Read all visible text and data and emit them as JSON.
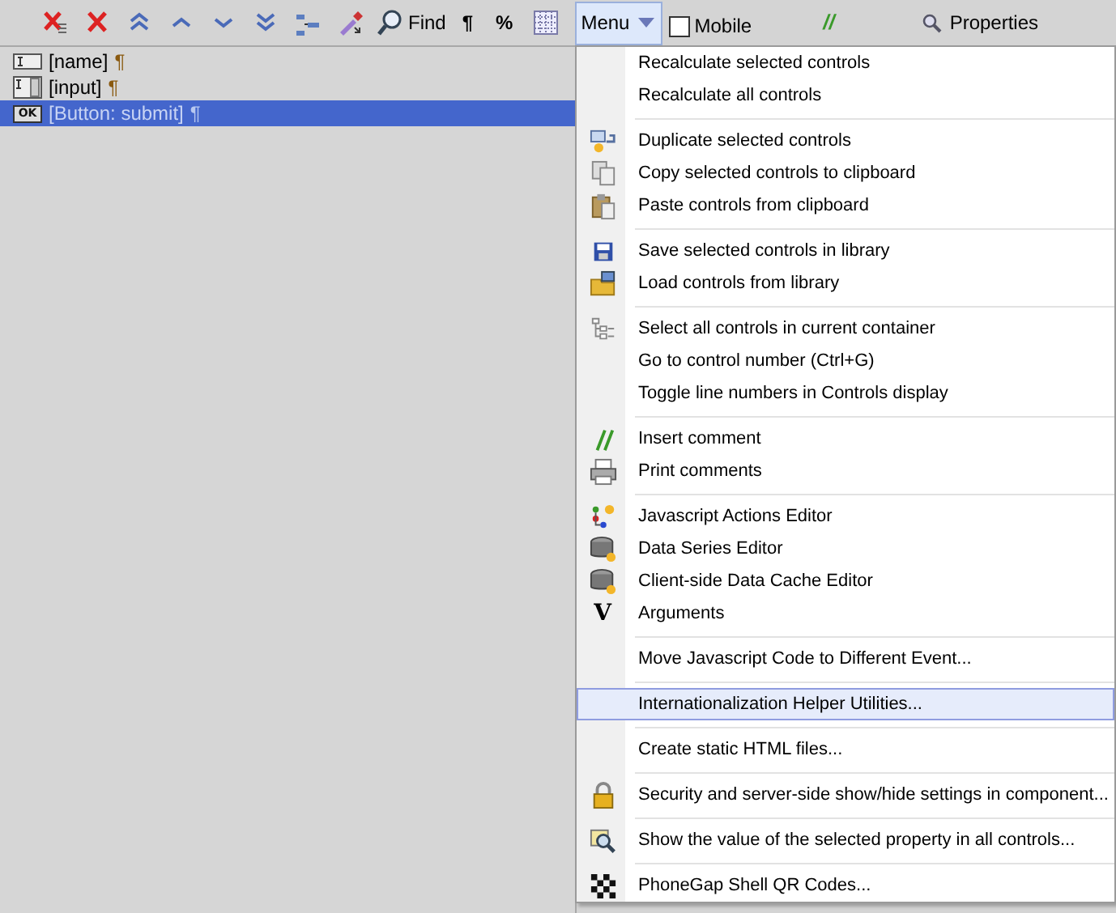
{
  "toolbar": {
    "buttons": [
      {
        "kind": "icon"
      },
      {
        "kind": "icon"
      },
      {
        "kind": "icon"
      },
      {
        "kind": "icon"
      },
      {
        "kind": "icon"
      },
      {
        "kind": "icon"
      },
      {
        "kind": "icon"
      },
      {
        "kind": "icon"
      },
      {
        "kind": "labeled",
        "label": "Find"
      },
      {
        "kind": "text",
        "label": "¶"
      },
      {
        "kind": "text",
        "label": "%"
      },
      {
        "kind": "icon"
      }
    ],
    "menu_button": {
      "label": "Menu",
      "selected": true
    },
    "mobile": {
      "label": "Mobile",
      "checked": false
    },
    "comment_mark": "//",
    "properties": {
      "label": "Properties"
    }
  },
  "controls": [
    {
      "label": "[name]",
      "mark": "¶",
      "selected": false
    },
    {
      "label": "[input]",
      "mark": "¶",
      "selected": false
    },
    {
      "badge": "OK",
      "label": "[Button: submit]",
      "mark": "¶",
      "selected": true
    }
  ],
  "menu": [
    {
      "kind": "item",
      "label": "Recalculate selected controls",
      "highlighted": false
    },
    {
      "kind": "item",
      "label": "Recalculate all controls",
      "highlighted": false
    },
    {
      "kind": "separator"
    },
    {
      "kind": "item",
      "label": "Duplicate selected controls",
      "highlighted": false
    },
    {
      "kind": "item",
      "label": "Copy selected controls to clipboard",
      "highlighted": false
    },
    {
      "kind": "item",
      "label": "Paste controls from clipboard",
      "highlighted": false
    },
    {
      "kind": "separator"
    },
    {
      "kind": "item",
      "label": "Save selected controls in library",
      "highlighted": false
    },
    {
      "kind": "item",
      "label": "Load controls from library",
      "highlighted": false
    },
    {
      "kind": "separator"
    },
    {
      "kind": "item",
      "label": "Select all controls in current container",
      "highlighted": false
    },
    {
      "kind": "item",
      "label": "Go to control number (Ctrl+G)",
      "highlighted": false
    },
    {
      "kind": "item",
      "label": "Toggle line numbers in Controls display",
      "highlighted": false
    },
    {
      "kind": "separator"
    },
    {
      "kind": "item",
      "label": "Insert comment",
      "highlighted": false
    },
    {
      "kind": "item",
      "label": "Print comments",
      "highlighted": false
    },
    {
      "kind": "separator"
    },
    {
      "kind": "item",
      "label": "Javascript Actions Editor",
      "highlighted": false
    },
    {
      "kind": "item",
      "label": "Data Series Editor",
      "highlighted": false
    },
    {
      "kind": "item",
      "label": "Client-side Data Cache Editor",
      "highlighted": false
    },
    {
      "kind": "item",
      "glyph": "V",
      "label": "Arguments",
      "highlighted": false
    },
    {
      "kind": "separator"
    },
    {
      "kind": "item",
      "label": "Move Javascript Code to Different Event...",
      "highlighted": false
    },
    {
      "kind": "separator"
    },
    {
      "kind": "item",
      "label": "Internationalization Helper Utilities...",
      "highlighted": true
    },
    {
      "kind": "separator"
    },
    {
      "kind": "item",
      "label": "Create static HTML files...",
      "highlighted": false
    },
    {
      "kind": "separator"
    },
    {
      "kind": "item",
      "label": "Security and server-side show/hide settings in component...",
      "highlighted": false
    },
    {
      "kind": "separator"
    },
    {
      "kind": "item",
      "label": "Show the value of the selected property in all controls...",
      "highlighted": false
    },
    {
      "kind": "separator"
    },
    {
      "kind": "item",
      "label": "PhoneGap Shell QR Codes...",
      "highlighted": false
    }
  ]
}
